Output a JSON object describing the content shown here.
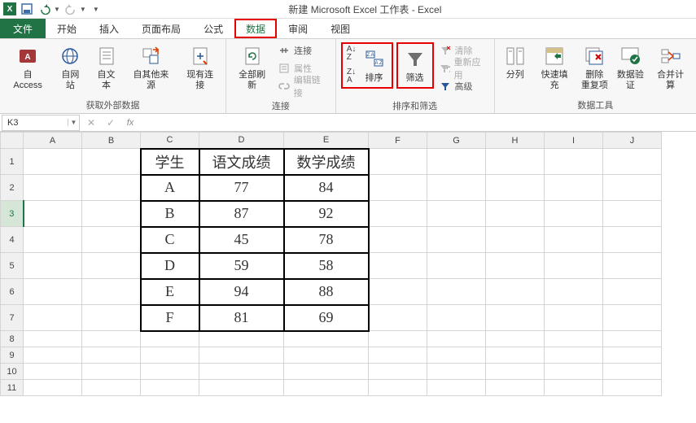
{
  "titlebar": {
    "title": "新建 Microsoft Excel 工作表 - Excel"
  },
  "tabs": {
    "file": "文件",
    "home": "开始",
    "insert": "插入",
    "layout": "页面布局",
    "formulas": "公式",
    "data": "数据",
    "review": "审阅",
    "view": "视图"
  },
  "ribbon": {
    "ext_data": {
      "access": "自 Access",
      "web": "自网站",
      "text": "自文本",
      "other": "自其他来源",
      "existing": "现有连接",
      "group_label": "获取外部数据"
    },
    "conn": {
      "refresh": "全部刷新",
      "connections": "连接",
      "properties": "属性",
      "edit_links": "编辑链接",
      "group_label": "连接"
    },
    "sort_filter": {
      "sort": "排序",
      "filter": "筛选",
      "clear": "清除",
      "reapply": "重新应用",
      "advanced": "高级",
      "group_label": "排序和筛选"
    },
    "tools": {
      "text_cols": "分列",
      "flash_fill": "快速填充",
      "remove_dup": "删除\n重复项",
      "validation": "数据验\n证",
      "consolidate": "合并计算",
      "group_label": "数据工具"
    }
  },
  "namebox": {
    "value": "K3"
  },
  "columns": [
    "A",
    "B",
    "C",
    "D",
    "E",
    "F",
    "G",
    "H",
    "I",
    "J"
  ],
  "row_headers": [
    "1",
    "2",
    "3",
    "4",
    "5",
    "6",
    "7",
    "8",
    "9",
    "10",
    "11"
  ],
  "chart_data": {
    "type": "table",
    "title": "",
    "headers": [
      "学生",
      "语文成绩",
      "数学成绩"
    ],
    "rows": [
      [
        "A",
        "77",
        "84"
      ],
      [
        "B",
        "87",
        "92"
      ],
      [
        "C",
        "45",
        "78"
      ],
      [
        "D",
        "59",
        "58"
      ],
      [
        "E",
        "94",
        "88"
      ],
      [
        "F",
        "81",
        "69"
      ]
    ]
  },
  "selected_row": "3"
}
